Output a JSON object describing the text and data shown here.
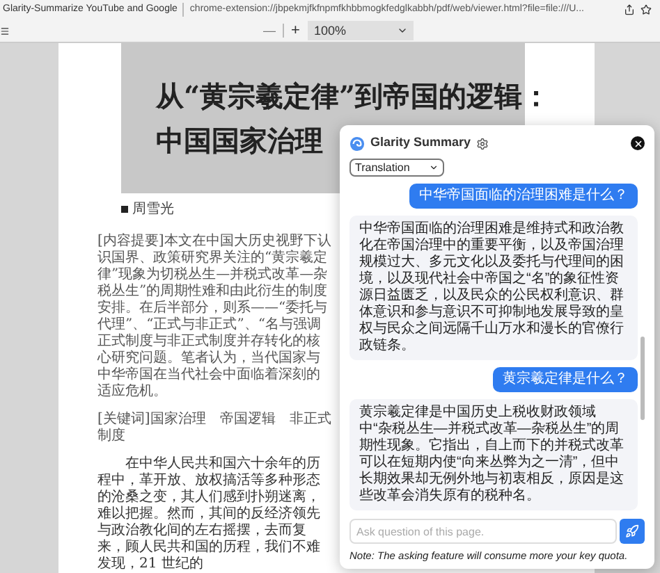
{
  "browser": {
    "tab_title": "Glarity-Summarize YouTube and Google",
    "address": "chrome-extension://jbpekmjfkfnpmfkhbbmogkfedglkabbh/pdf/web/viewer.html?file=file:///U..."
  },
  "pdf_toolbar": {
    "zoom_out": "—",
    "zoom_in": "+",
    "zoom": "100%"
  },
  "document": {
    "title_lines": [
      "从“黄宗羲定律”到帝国的逻辑：",
      "中国国家治理"
    ],
    "author": "周雪光",
    "abstract": "[内容提要]本文在中国大历史视野下认识国界、政策研究界关注的“黄宗羲定律”现象为切税丛生—并税式改革—杂税丛生”的周期性难和由此衍生的制度安排。在后半部分，则系——“委托与代理”、“正式与非正式”、“名与强调正式制度与非正式制度并存转化的核心研究问题。笔者认为，当代国家与中华帝国在当代社会中面临着深刻的适应危机。",
    "keywords": "[关键词]国家治理　帝国逻辑　非正式制度",
    "body": "在中华人民共和国六十余年的历程中，革开放、放权搞活等多种形态的沧桑之变，其人们感到扑朔迷离，难以把握。然而，其间的反经济领先与政治教化间的左右摇摆，去而复来，顾人民共和国的历程，我们不难发现，21 世纪的"
  },
  "panel": {
    "title": "Glarity Summary",
    "mode": "Translation",
    "messages": [
      {
        "kind": "question",
        "text": "中华帝国面临的治理困难是什么？"
      },
      {
        "kind": "answer",
        "text": "中华帝国面临的治理困难是维持式和政治教化在帝国治理中的重要平衡，以及帝国治理规模过大、多元文化以及委托与代理间的困境，以及现代社会中帝国之“名”的象征性资源日益匮乏，以及民众的公民权利意识、群体意识和参与意识不可抑制地发展导致的皇权与民众之间远隔千山万水和漫长的官僚行政链条。"
      },
      {
        "kind": "question",
        "text": "黄宗羲定律是什么？"
      },
      {
        "kind": "answer",
        "text": "黄宗羲定律是中国历史上税收财政领域中“杂税丛生—并税式改革—杂税丛生”的周期性现象。它指出，自上而下的并税式改革可以在短期内使“向来丛弊为之一清”，但中长期效果却无例外地与初衷相反，原因是这些改革会消失原有的税种名。"
      }
    ],
    "input": {
      "placeholder": "Ask question of this page."
    },
    "note": "Note: The asking feature will consume more your key quota."
  }
}
